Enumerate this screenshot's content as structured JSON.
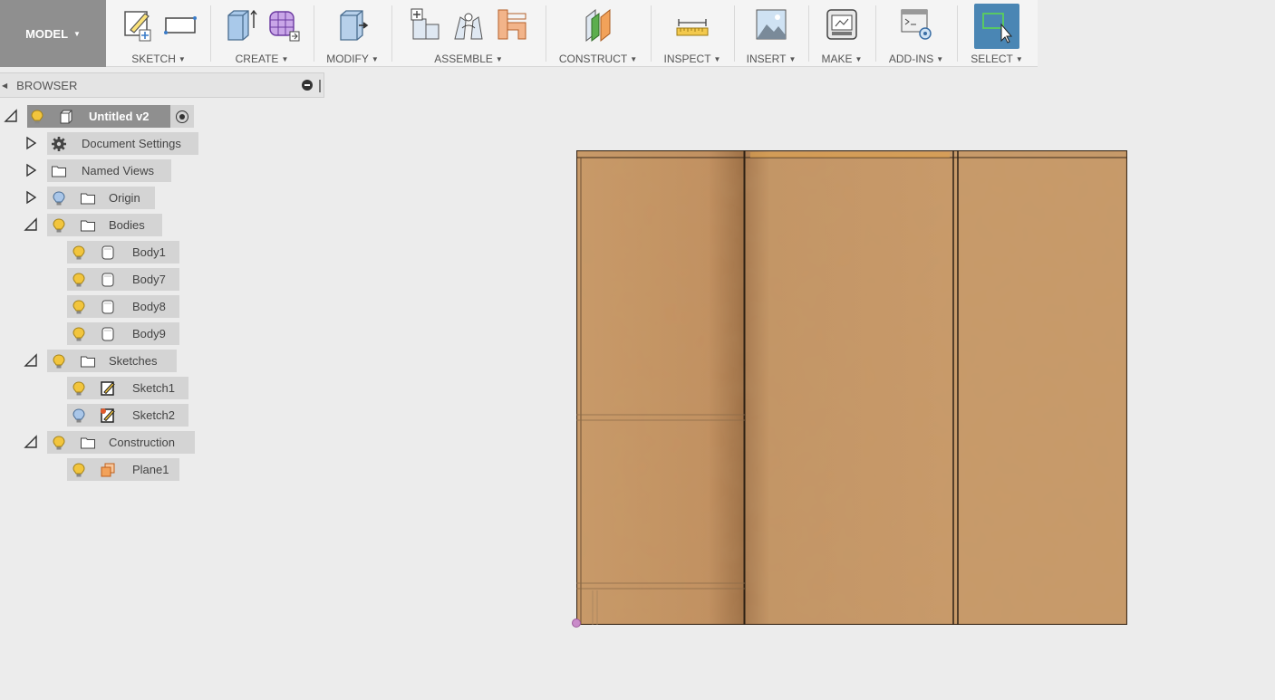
{
  "toolbar": {
    "workspace": "MODEL",
    "groups": {
      "sketch": "SKETCH",
      "create": "CREATE",
      "modify": "MODIFY",
      "assemble": "ASSEMBLE",
      "construct": "CONSTRUCT",
      "inspect": "INSPECT",
      "insert": "INSERT",
      "make": "MAKE",
      "addins": "ADD-INS",
      "select": "SELECT"
    },
    "icons": {
      "sketch": [
        "create-sketch-icon",
        "rectangle-icon"
      ],
      "create": [
        "extrude-icon",
        "create-form-icon"
      ],
      "modify": [
        "press-pull-icon"
      ],
      "assemble": [
        "new-component-icon",
        "joint-icon",
        "as-built-joint-icon"
      ],
      "construct": [
        "offset-plane-icon"
      ],
      "inspect": [
        "measure-icon"
      ],
      "insert": [
        "insert-image-icon"
      ],
      "make": [
        "3d-print-icon"
      ],
      "addins": [
        "scripts-addins-icon"
      ],
      "select": [
        "window-select-icon"
      ]
    },
    "selected_tool": "SELECT"
  },
  "browser": {
    "title": "BROWSER",
    "root": "Untitled v2",
    "items": {
      "document_settings": "Document Settings",
      "named_views": "Named Views",
      "origin": "Origin",
      "bodies": "Bodies",
      "body1": "Body1",
      "body7": "Body7",
      "body8": "Body8",
      "body9": "Body9",
      "sketches": "Sketches",
      "sketch1": "Sketch1",
      "sketch2": "Sketch2",
      "construction": "Construction",
      "plane1": "Plane1"
    }
  },
  "colors": {
    "toolbar_bg": "#f4f4f4",
    "workspace_bg": "#8f8f8f",
    "select_accent": "#4a86b4",
    "canvas_bg": "#ececec",
    "wood": "#c69766",
    "bulb_on": "#f2c53d",
    "bulb_off": "#a9c6e8"
  }
}
